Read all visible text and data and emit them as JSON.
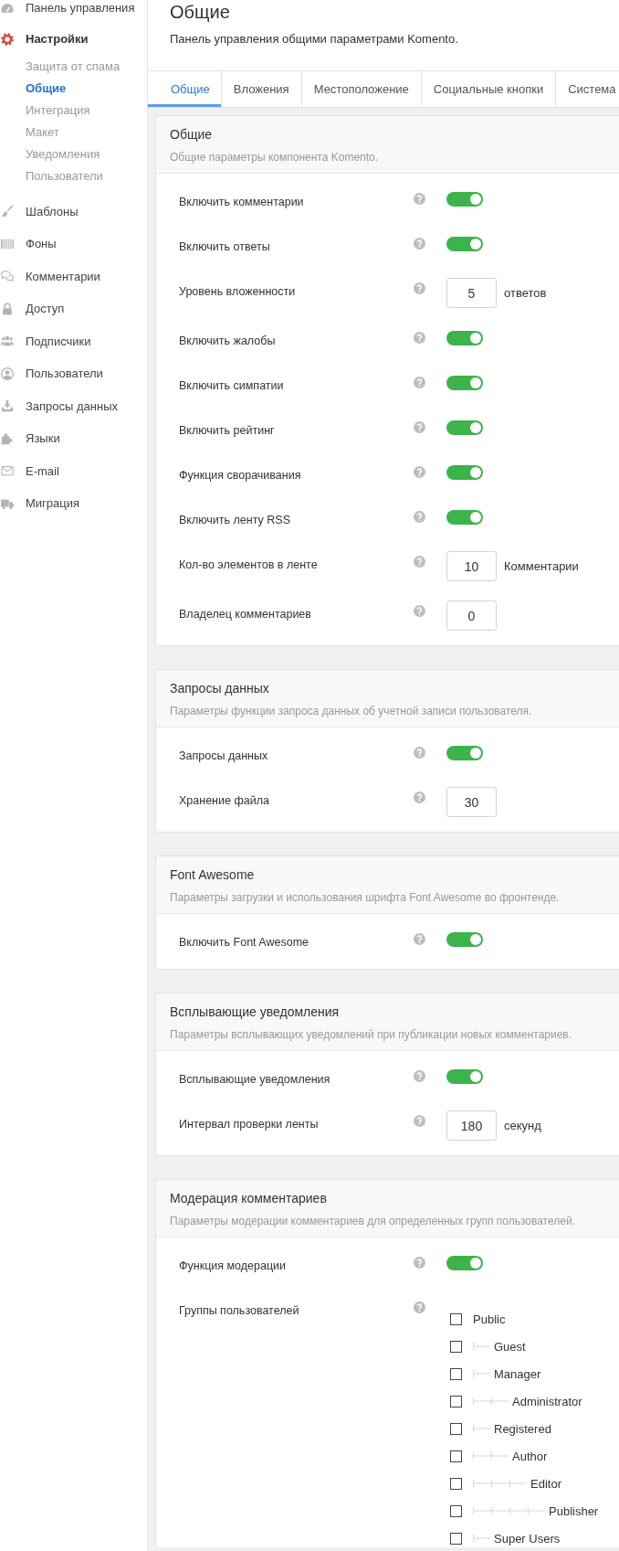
{
  "sidebar": {
    "items": [
      {
        "label": "Панель управления",
        "selected": false
      },
      {
        "label": "Настройки",
        "selected": true,
        "children": [
          {
            "label": "Защита от спама",
            "selected": false
          },
          {
            "label": "Общие",
            "selected": true
          },
          {
            "label": "Интеграция",
            "selected": false
          },
          {
            "label": "Макет",
            "selected": false
          },
          {
            "label": "Уведомления",
            "selected": false
          },
          {
            "label": "Пользователи",
            "selected": false
          }
        ]
      },
      {
        "label": "Шаблоны",
        "selected": false
      },
      {
        "label": "Фоны",
        "selected": false
      },
      {
        "label": "Комментарии",
        "selected": false
      },
      {
        "label": "Доступ",
        "selected": false
      },
      {
        "label": "Подписчики",
        "selected": false
      },
      {
        "label": "Пользователи",
        "selected": false
      },
      {
        "label": "Запросы данных",
        "selected": false
      },
      {
        "label": "Языки",
        "selected": false
      },
      {
        "label": "E-mail",
        "selected": false
      },
      {
        "label": "Миграция",
        "selected": false
      }
    ]
  },
  "header": {
    "title": "Общие",
    "description": "Панель управления общими параметрами Komento."
  },
  "tabs": [
    {
      "label": "Общие",
      "selected": true
    },
    {
      "label": "Вложения",
      "selected": false
    },
    {
      "label": "Местоположение",
      "selected": false
    },
    {
      "label": "Социальные кнопки",
      "selected": false
    },
    {
      "label": "Система",
      "selected": false
    }
  ],
  "sections": [
    {
      "title": "Общие",
      "description": "Общие параметры компонента Komento.",
      "settings": [
        {
          "kind": "toggle",
          "label": "Включить комментарии",
          "on": true
        },
        {
          "kind": "toggle",
          "label": "Включить ответы",
          "on": true
        },
        {
          "kind": "number",
          "label": "Уровень вложенности",
          "value": "5",
          "suffix": "ответов"
        },
        {
          "kind": "toggle",
          "label": "Включить жалобы",
          "on": true
        },
        {
          "kind": "toggle",
          "label": "Включить симпатии",
          "on": true
        },
        {
          "kind": "toggle",
          "label": "Включить рейтинг",
          "on": true
        },
        {
          "kind": "toggle",
          "label": "Функция сворачивания",
          "on": true
        },
        {
          "kind": "toggle",
          "label": "Включить ленту RSS",
          "on": true
        },
        {
          "kind": "number",
          "label": "Кол-во элементов в ленте",
          "value": "10",
          "suffix": "Комментарии"
        },
        {
          "kind": "number",
          "label": "Владелец комментариев",
          "value": "0"
        }
      ]
    },
    {
      "title": "Запросы данных",
      "description": "Параметры функции запроса данных об учетной записи пользователя.",
      "settings": [
        {
          "kind": "toggle",
          "label": "Запросы данных",
          "on": true
        },
        {
          "kind": "number",
          "label": "Хранение файла",
          "value": "30"
        }
      ]
    },
    {
      "title": "Font Awesome",
      "description": "Параметры загрузки и использования шрифта Font Awesome во фронтенде.",
      "settings": [
        {
          "kind": "toggle",
          "label": "Включить Font Awesome",
          "on": true
        }
      ]
    },
    {
      "title": "Всплывающие уведомления",
      "description": "Параметры всплывающих уведомлений при публикации новых комментариев.",
      "settings": [
        {
          "kind": "toggle",
          "label": "Всплывающие уведомления",
          "on": true
        },
        {
          "kind": "number",
          "label": "Интервал проверки ленты",
          "value": "180",
          "suffix": "секунд"
        }
      ]
    },
    {
      "title": "Модерация комментариев",
      "description": "Параметры модерации комментариев для определенных групп пользователей.",
      "settings": [
        {
          "kind": "toggle",
          "label": "Функция модерации",
          "on": true
        },
        {
          "kind": "tree",
          "label": "Группы пользователей",
          "groups": [
            {
              "label": "Public",
              "checked": false,
              "children": [
                {
                  "label": "Guest",
                  "checked": false
                },
                {
                  "label": "Manager",
                  "checked": false,
                  "children": [
                    {
                      "label": "Administrator",
                      "checked": false
                    }
                  ]
                },
                {
                  "label": "Registered",
                  "checked": false,
                  "children": [
                    {
                      "label": "Author",
                      "checked": false,
                      "children": [
                        {
                          "label": "Editor",
                          "checked": false,
                          "children": [
                            {
                              "label": "Publisher",
                              "checked": false
                            }
                          ]
                        }
                      ]
                    }
                  ]
                },
                {
                  "label": "Super Users",
                  "checked": false
                }
              ]
            }
          ]
        }
      ]
    }
  ]
}
